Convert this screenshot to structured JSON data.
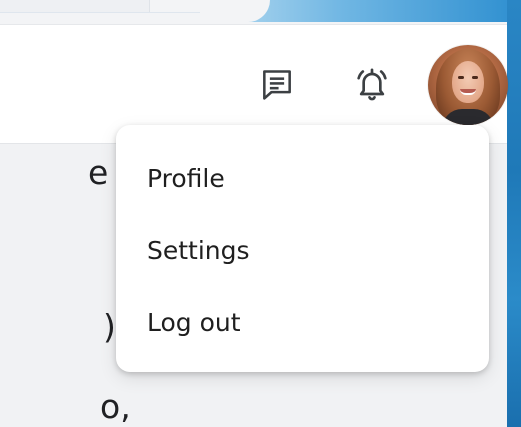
{
  "header": {
    "icons": {
      "messages": "message-square-icon",
      "notifications": "bell-icon"
    }
  },
  "page": {
    "fragments": [
      "e",
      ")",
      "o,"
    ]
  },
  "menu": {
    "items": [
      {
        "label": "Profile"
      },
      {
        "label": "Settings"
      },
      {
        "label": "Log out"
      }
    ]
  },
  "colors": {
    "background": "#f1f2f4",
    "header": "#ffffff",
    "menu": "#ffffff",
    "text": "#1f1f1f",
    "desktop_edge": "#2a86c5"
  }
}
